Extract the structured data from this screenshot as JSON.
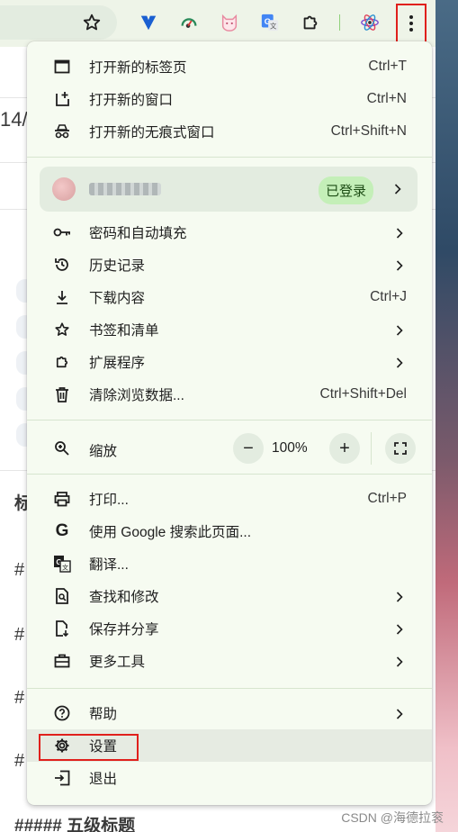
{
  "menu": {
    "new_tab": {
      "label": "打开新的标签页",
      "shortcut": "Ctrl+T"
    },
    "new_window": {
      "label": "打开新的窗口",
      "shortcut": "Ctrl+N"
    },
    "incognito": {
      "label": "打开新的无痕式窗口",
      "shortcut": "Ctrl+Shift+N"
    },
    "profile": {
      "badge": "已登录"
    },
    "passwords": {
      "label": "密码和自动填充"
    },
    "history": {
      "label": "历史记录"
    },
    "downloads": {
      "label": "下载内容",
      "shortcut": "Ctrl+J"
    },
    "bookmarks": {
      "label": "书签和清单"
    },
    "extensions": {
      "label": "扩展程序"
    },
    "clear_data": {
      "label": "清除浏览数据...",
      "shortcut": "Ctrl+Shift+Del"
    },
    "zoom": {
      "label": "缩放",
      "minus": "−",
      "value": "100%",
      "plus": "+"
    },
    "print": {
      "label": "打印...",
      "shortcut": "Ctrl+P"
    },
    "google_search": {
      "label": "使用 Google 搜索此页面..."
    },
    "translate": {
      "label": "翻译..."
    },
    "find_edit": {
      "label": "查找和修改"
    },
    "save_share": {
      "label": "保存并分享"
    },
    "more_tools": {
      "label": "更多工具"
    },
    "help": {
      "label": "帮助"
    },
    "settings": {
      "label": "设置"
    },
    "exit": {
      "label": "退出"
    }
  },
  "background": {
    "line1": "14/",
    "heading_fragment": "标",
    "hash_fragment": "#",
    "bottom_heading": "##### 五级标题"
  },
  "watermark": "CSDN @海德拉衮",
  "icons": [
    "star-icon",
    "extension-v-icon",
    "gauge-icon",
    "cat-icon",
    "google-translate-icon",
    "puzzle-icon",
    "atom-icon",
    "kebab-menu-icon"
  ],
  "colors": {
    "menu_bg": "#f6fbf1",
    "highlight_box": "#e0201c",
    "badge_bg": "#c4efb8"
  }
}
